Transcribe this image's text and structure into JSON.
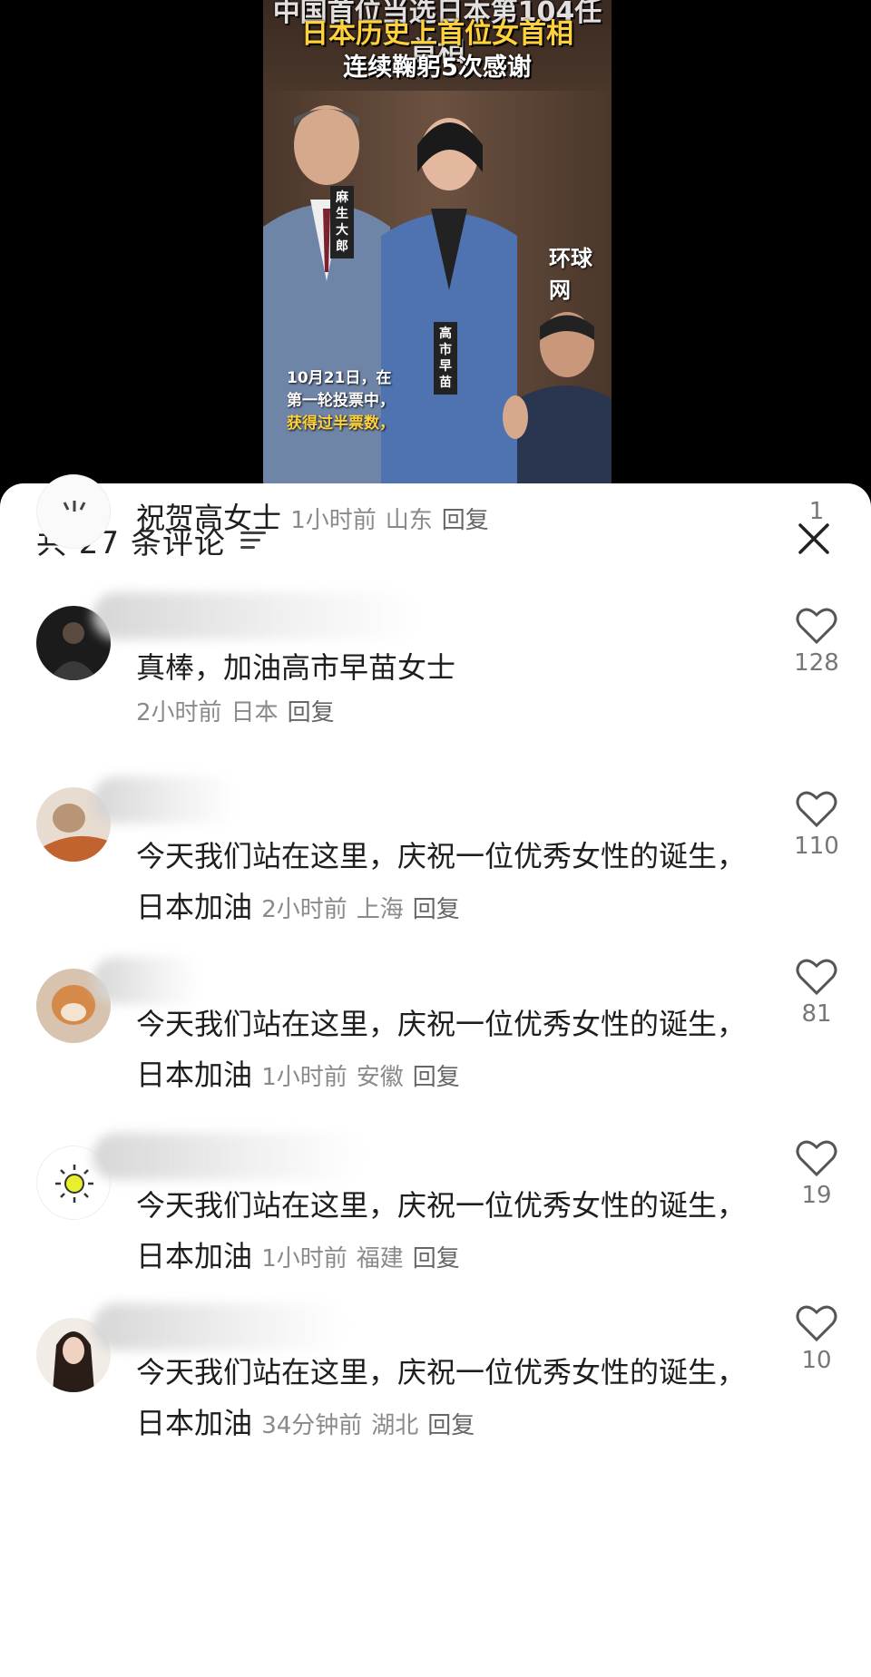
{
  "video": {
    "caption_top": "中国首位当选日本第104任首相",
    "caption_1": "日本历史上首位女首相",
    "caption_2": "连续鞠躬5次感谢",
    "watermark": "环球网",
    "nameplate_1": "麻生大郎",
    "nameplate_2": "高市早苗",
    "subtitle_1": "10月21日，在",
    "subtitle_2": "第一轮投票中，",
    "subtitle_3": "获得过半票数，"
  },
  "sheet": {
    "count_label": "共 27 条评论",
    "filter_icon": "filter-icon",
    "close_icon": "close-icon"
  },
  "comments": [
    {
      "text": "祝贺高女士",
      "time": "1小时前",
      "location": "山东",
      "reply": "回复",
      "likes": "1"
    },
    {
      "text": "真棒，加油高市早苗女士",
      "time": "2小时前",
      "location": "日本",
      "reply": "回复",
      "likes": "128"
    },
    {
      "text": "今天我们站在这里，庆祝一位优秀女性的诞生，日本加油",
      "time": "2小时前",
      "location": "上海",
      "reply": "回复",
      "likes": "110"
    },
    {
      "text": "今天我们站在这里，庆祝一位优秀女性的诞生，日本加油",
      "time": "1小时前",
      "location": "安徽",
      "reply": "回复",
      "likes": "81"
    },
    {
      "text": "今天我们站在这里，庆祝一位优秀女性的诞生，日本加油",
      "time": "1小时前",
      "location": "福建",
      "reply": "回复",
      "likes": "19"
    },
    {
      "text": "今天我们站在这里，庆祝一位优秀女性的诞生，日本加油",
      "time": "34分钟前",
      "location": "湖北",
      "reply": "回复",
      "likes": "10"
    }
  ],
  "colors": {
    "caption_yellow": "#ffd23c",
    "sheet_bg": "#ffffff",
    "meta_gray": "#8a8a8a"
  }
}
